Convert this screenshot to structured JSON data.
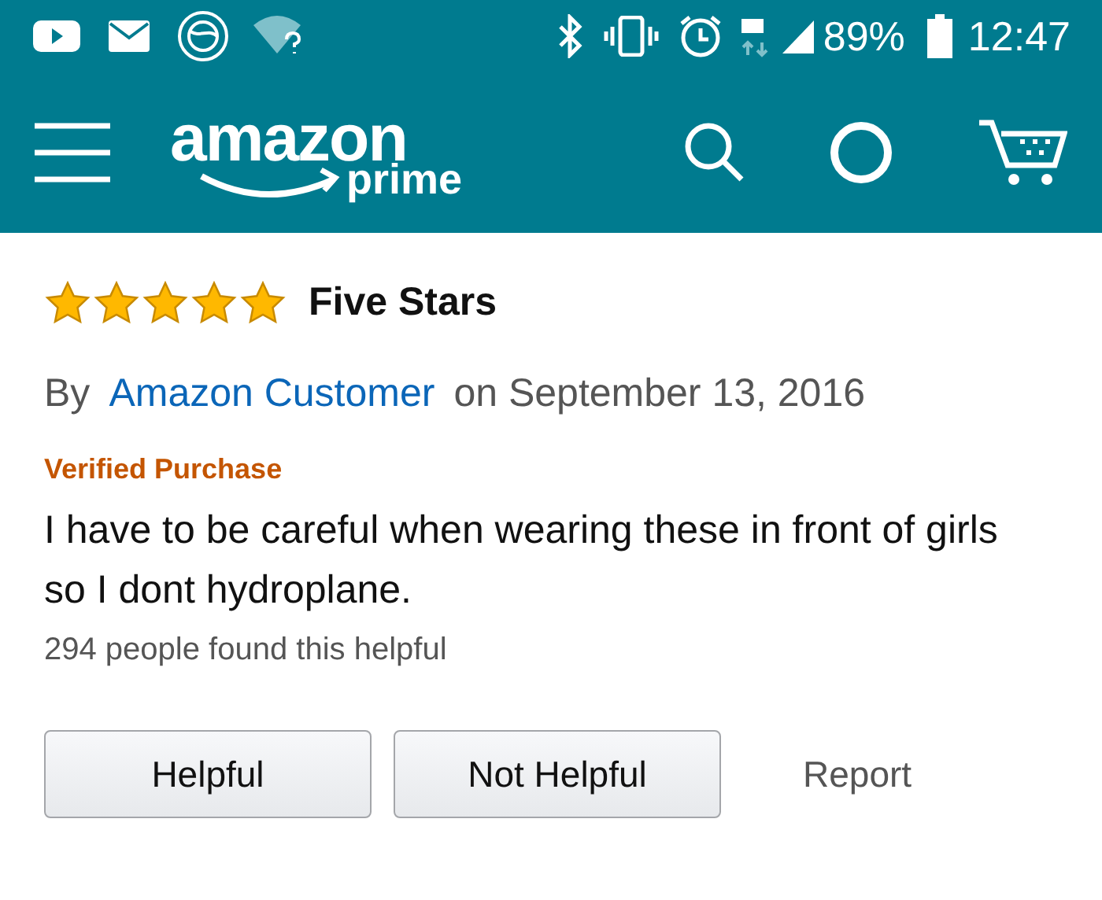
{
  "status_bar": {
    "battery": "89%",
    "time": "12:47"
  },
  "header": {
    "logo_word": "amazon",
    "logo_sub": "prime"
  },
  "review": {
    "stars": 5,
    "title": "Five Stars",
    "by": "By",
    "author": "Amazon Customer",
    "date": "on September 13, 2016",
    "badge": "Verified Purchase",
    "body": "I have to be careful when wearing these in front of girls so I dont hydroplane.",
    "helpful_count": "294 people found this helpful"
  },
  "actions": [
    {
      "kind": "button",
      "label": "Helpful"
    },
    {
      "kind": "button",
      "label": "Not Helpful"
    },
    {
      "kind": "link",
      "label": "Report"
    }
  ]
}
